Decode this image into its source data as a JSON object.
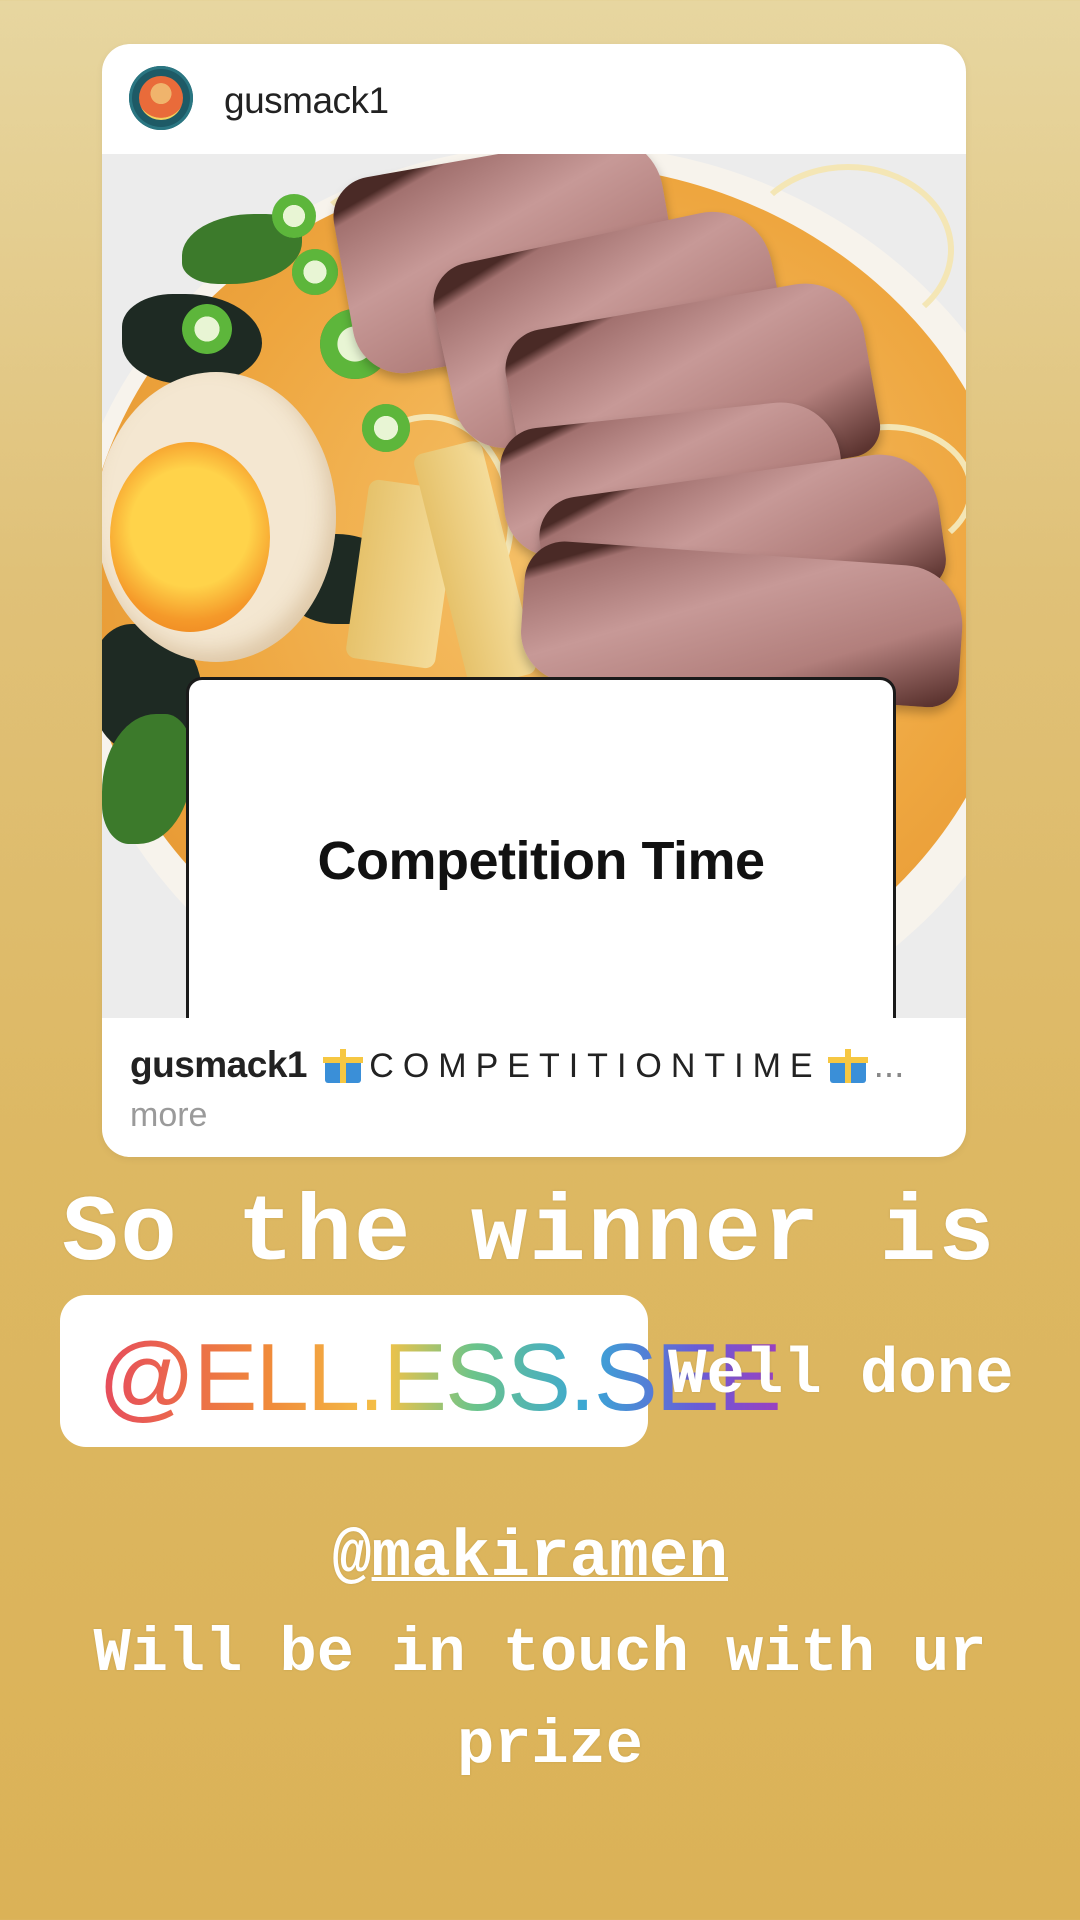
{
  "post": {
    "author": "gusmack1",
    "sticker_text": "Competition Time",
    "caption_user": "gusmack1",
    "caption_text": "COMPETITIONTIME",
    "caption_ellipsis": "...",
    "more_label": "more"
  },
  "story": {
    "headline": "So the winner is",
    "winner_mention": "@ELL.ESS.SEE",
    "congrats": "Well done",
    "sponsor_at": "@",
    "sponsor_name": "makiramen",
    "line_prize_1": "Will be in touch with ur",
    "line_prize_2": "prize"
  },
  "colors": {
    "background_top": "#e7d6a0",
    "background_bottom": "#dbb257",
    "mention_gradient": [
      "#e64b5d",
      "#f08a3a",
      "#f4c247",
      "#6cc48a",
      "#3aa6d6",
      "#9b3fc0"
    ]
  },
  "icons": [
    "avatar",
    "gift-icon"
  ]
}
